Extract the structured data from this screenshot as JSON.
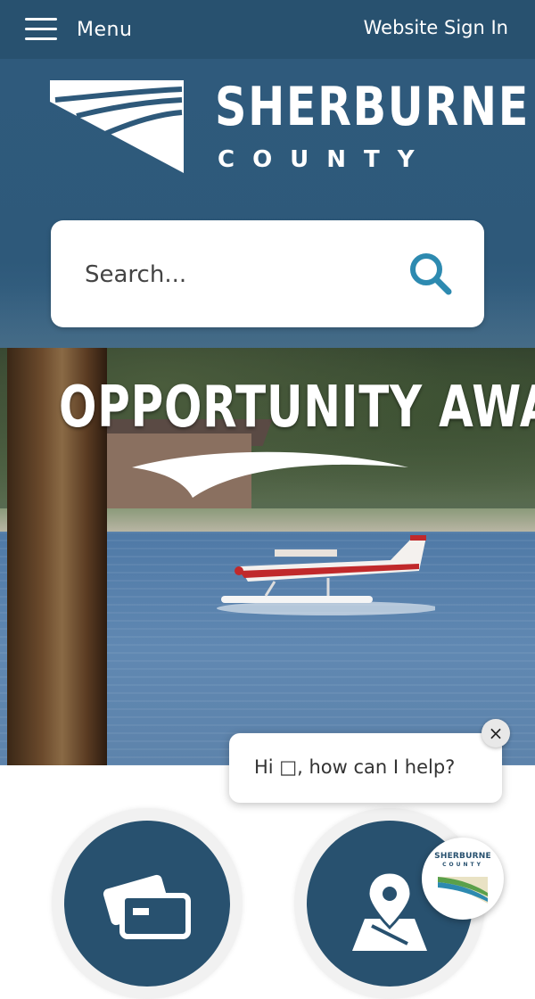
{
  "topbar": {
    "menu_label": "Menu",
    "menu_icon": "hamburger-icon",
    "signin_label": "Website Sign In"
  },
  "logo": {
    "name": "SHERBURNE",
    "sub": "COUNTY"
  },
  "search": {
    "placeholder": "Search...",
    "icon": "search-icon"
  },
  "hero": {
    "title": "OPPORTUNITY AWAITS"
  },
  "quick_links": [
    {
      "icon": "credit-card-icon"
    },
    {
      "icon": "map-pin-icon"
    }
  ],
  "chat": {
    "greeting": "Hi □, how can I help?",
    "close_label": "×",
    "launcher_name": "SHERBURNE",
    "launcher_sub": "COUNTY"
  },
  "colors": {
    "brand_blue": "#28516f",
    "search_accent": "#2d8ab0"
  }
}
